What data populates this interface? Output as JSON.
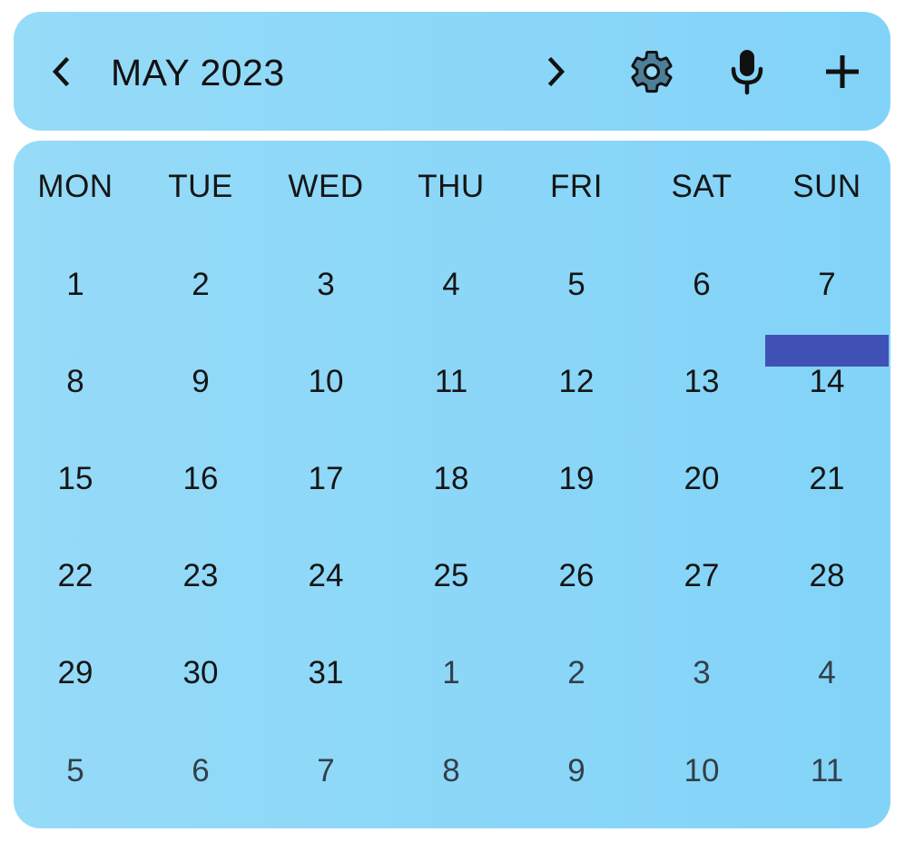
{
  "header": {
    "month_title": "MAY 2023",
    "prev_icon": "chevron-left-icon",
    "next_icon": "chevron-right-icon",
    "settings_icon": "gear-icon",
    "voice_icon": "microphone-icon",
    "add_icon": "plus-icon"
  },
  "weekdays": [
    "MON",
    "TUE",
    "WED",
    "THU",
    "FRI",
    "SAT",
    "SUN"
  ],
  "weeks": [
    [
      {
        "d": "1",
        "out": false
      },
      {
        "d": "2",
        "out": false
      },
      {
        "d": "3",
        "out": false
      },
      {
        "d": "4",
        "out": false
      },
      {
        "d": "5",
        "out": false
      },
      {
        "d": "6",
        "out": false
      },
      {
        "d": "7",
        "out": false
      }
    ],
    [
      {
        "d": "8",
        "out": false
      },
      {
        "d": "9",
        "out": false
      },
      {
        "d": "10",
        "out": false
      },
      {
        "d": "11",
        "out": false
      },
      {
        "d": "12",
        "out": false
      },
      {
        "d": "13",
        "out": false
      },
      {
        "d": "14",
        "out": false
      }
    ],
    [
      {
        "d": "15",
        "out": false
      },
      {
        "d": "16",
        "out": false
      },
      {
        "d": "17",
        "out": false
      },
      {
        "d": "18",
        "out": false
      },
      {
        "d": "19",
        "out": false
      },
      {
        "d": "20",
        "out": false
      },
      {
        "d": "21",
        "out": false
      }
    ],
    [
      {
        "d": "22",
        "out": false
      },
      {
        "d": "23",
        "out": false
      },
      {
        "d": "24",
        "out": false
      },
      {
        "d": "25",
        "out": false
      },
      {
        "d": "26",
        "out": false
      },
      {
        "d": "27",
        "out": false
      },
      {
        "d": "28",
        "out": false
      }
    ],
    [
      {
        "d": "29",
        "out": false
      },
      {
        "d": "30",
        "out": false
      },
      {
        "d": "31",
        "out": false
      },
      {
        "d": "1",
        "out": true
      },
      {
        "d": "2",
        "out": true
      },
      {
        "d": "3",
        "out": true
      },
      {
        "d": "4",
        "out": true
      }
    ],
    [
      {
        "d": "5",
        "out": true
      },
      {
        "d": "6",
        "out": true
      },
      {
        "d": "7",
        "out": true
      },
      {
        "d": "8",
        "out": true
      },
      {
        "d": "9",
        "out": true
      },
      {
        "d": "10",
        "out": true
      },
      {
        "d": "11",
        "out": true
      }
    ]
  ],
  "event": {
    "on_day": "14",
    "color": "#3f51b5"
  },
  "colors": {
    "background_start": "#96dbf8",
    "background_end": "#82d3f8",
    "text": "#151515",
    "outside_month_text": "#333f48"
  }
}
